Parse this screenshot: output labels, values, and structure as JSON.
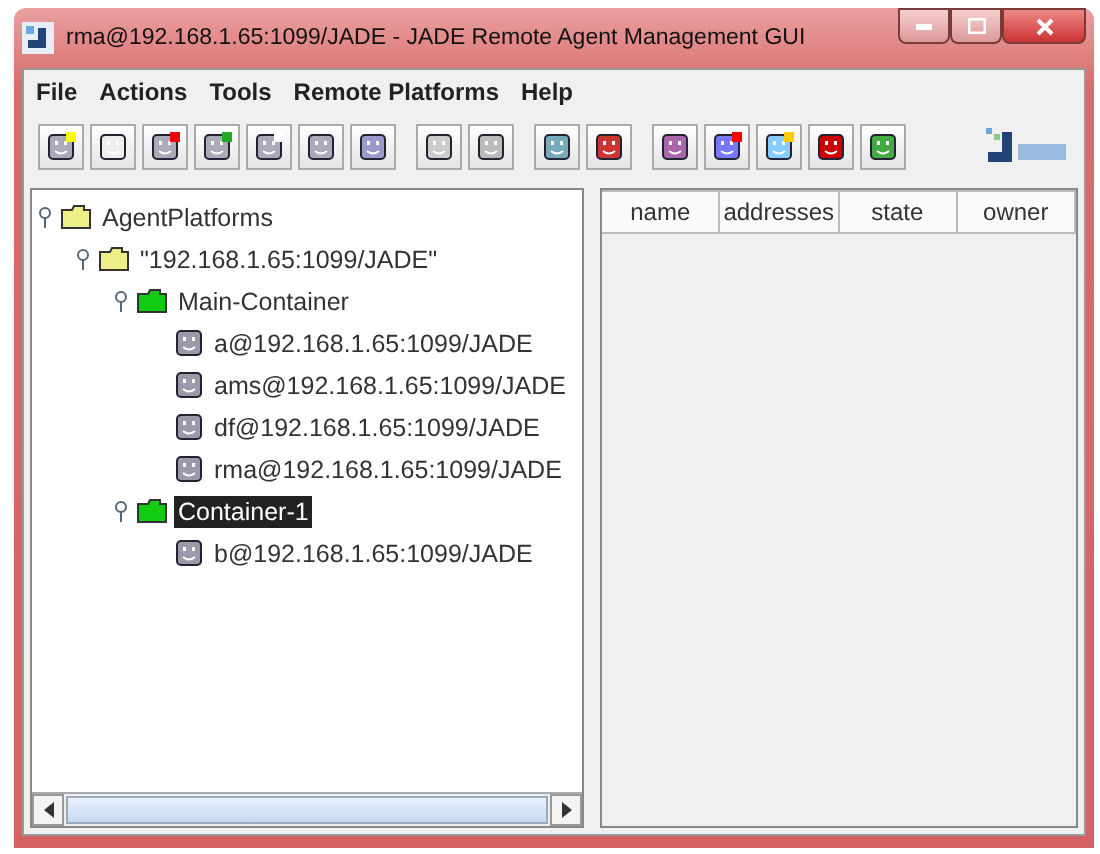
{
  "window": {
    "title": "rma@192.168.1.65:1099/JADE - JADE Remote Agent Management GUI"
  },
  "menu": [
    "File",
    "Actions",
    "Tools",
    "Remote Platforms",
    "Help"
  ],
  "toolbar": [
    {
      "buttons": [
        {
          "kind": "new"
        },
        {
          "kind": "kill"
        },
        {
          "kind": "suspend"
        },
        {
          "kind": "resume"
        },
        {
          "kind": "message"
        },
        {
          "kind": "migrate"
        },
        {
          "kind": "clone"
        }
      ]
    },
    {
      "buttons": [
        {
          "kind": "load"
        },
        {
          "kind": "save"
        }
      ]
    },
    {
      "buttons": [
        {
          "kind": "add"
        },
        {
          "kind": "remove"
        }
      ]
    },
    {
      "buttons": [
        {
          "kind": "sniffer"
        },
        {
          "kind": "dummy"
        },
        {
          "kind": "introspector"
        },
        {
          "kind": "debugger"
        },
        {
          "kind": "log"
        }
      ]
    }
  ],
  "tree": [
    {
      "label": "AgentPlatforms",
      "kind": "folder",
      "expanded": true,
      "selected": false,
      "children": [
        {
          "label": "\"192.168.1.65:1099/JADE\"",
          "kind": "folder",
          "expanded": true,
          "selected": false,
          "children": [
            {
              "label": "Main-Container",
              "kind": "container",
              "expanded": true,
              "selected": false,
              "children": [
                {
                  "label": "a@192.168.1.65:1099/JADE",
                  "kind": "agent",
                  "selected": false
                },
                {
                  "label": "ams@192.168.1.65:1099/JADE",
                  "kind": "agent",
                  "selected": false
                },
                {
                  "label": "df@192.168.1.65:1099/JADE",
                  "kind": "agent",
                  "selected": false
                },
                {
                  "label": "rma@192.168.1.65:1099/JADE",
                  "kind": "agent",
                  "selected": false
                }
              ]
            },
            {
              "label": "Container-1",
              "kind": "container",
              "expanded": true,
              "selected": true,
              "children": [
                {
                  "label": "b@192.168.1.65:1099/JADE",
                  "kind": "agent",
                  "selected": false
                }
              ]
            }
          ]
        }
      ]
    }
  ],
  "table": {
    "columns": [
      "name",
      "addresses",
      "state",
      "owner"
    ]
  }
}
